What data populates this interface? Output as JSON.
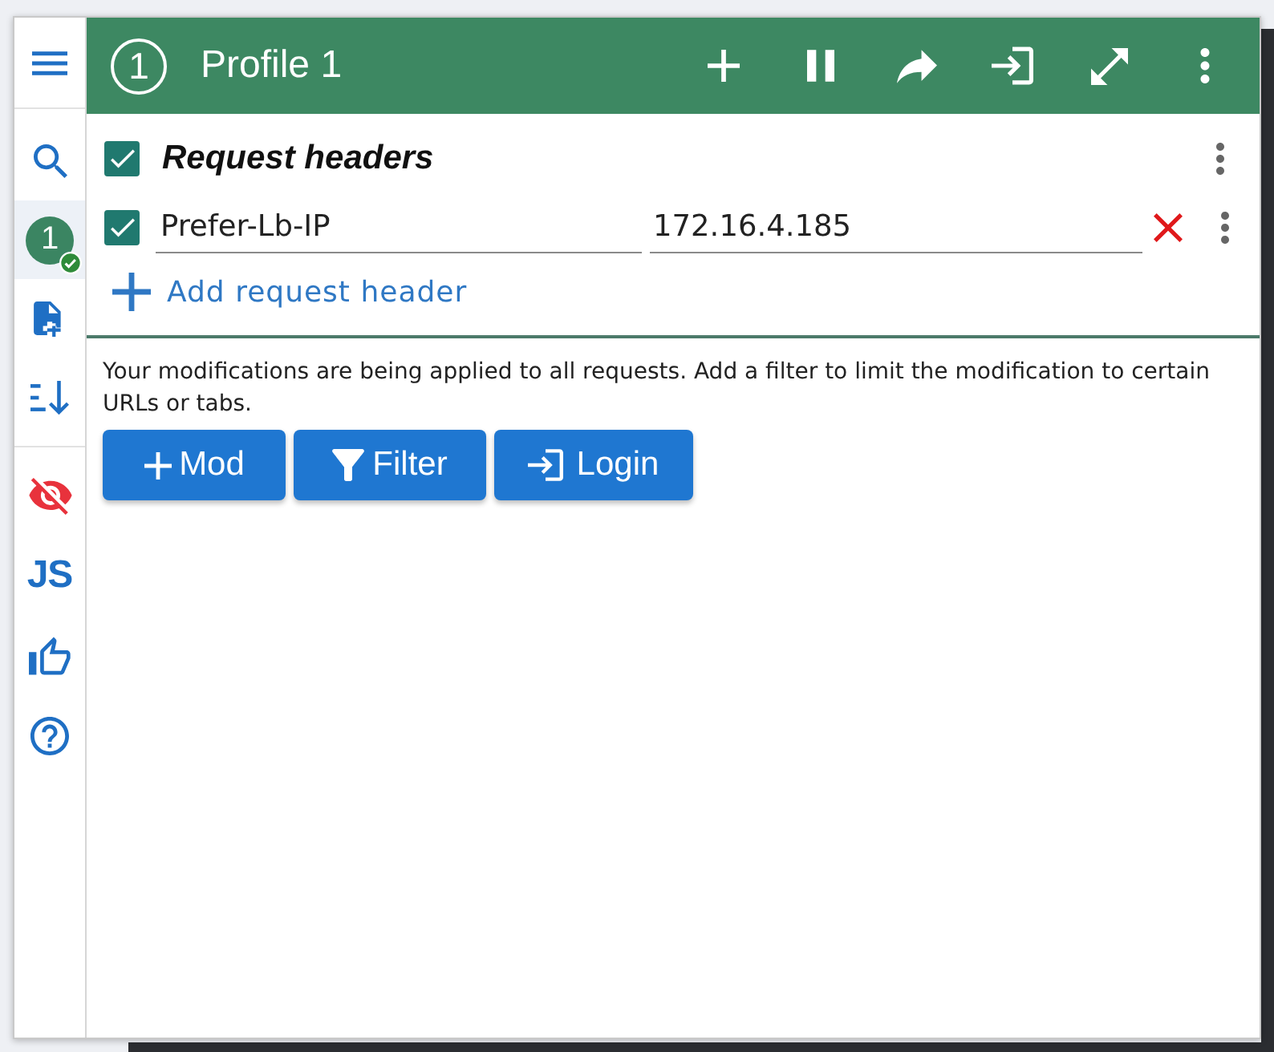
{
  "sidebar": {
    "profiles": [
      {
        "label": "1",
        "selected": true,
        "active": true
      }
    ],
    "js_label": "JS"
  },
  "header": {
    "badge": "1",
    "title": "Profile 1"
  },
  "request_headers": {
    "title": "Request headers",
    "checked": true,
    "rows": [
      {
        "checked": true,
        "name": "Prefer-Lb-IP",
        "value": "172.16.4.185"
      }
    ],
    "add_label": "Add request header"
  },
  "notice": "Your modifications are being applied to all requests. Add a filter to limit the modification to certain URLs or tabs.",
  "buttons": [
    {
      "kind": "mod",
      "label": "Mod"
    },
    {
      "kind": "filter",
      "label": "Filter"
    },
    {
      "kind": "login",
      "label": "Login"
    }
  ]
}
